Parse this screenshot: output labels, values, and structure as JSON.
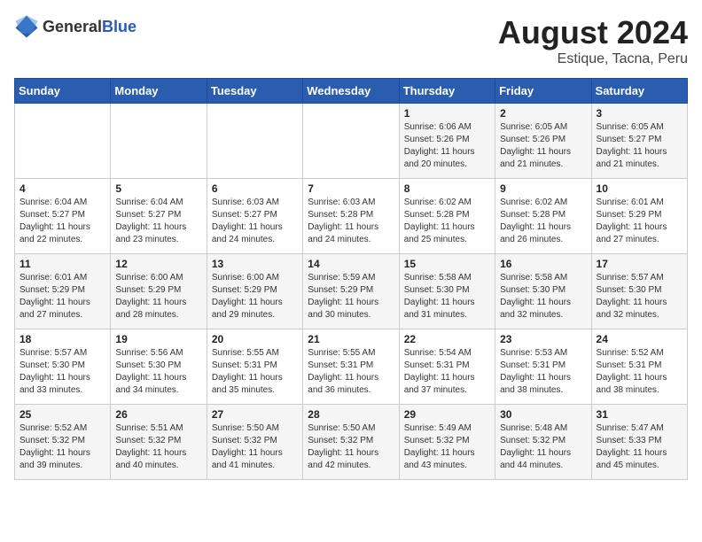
{
  "header": {
    "logo_general": "General",
    "logo_blue": "Blue",
    "month_year": "August 2024",
    "location": "Estique, Tacna, Peru"
  },
  "weekdays": [
    "Sunday",
    "Monday",
    "Tuesday",
    "Wednesday",
    "Thursday",
    "Friday",
    "Saturday"
  ],
  "weeks": [
    [
      {
        "day": "",
        "info": ""
      },
      {
        "day": "",
        "info": ""
      },
      {
        "day": "",
        "info": ""
      },
      {
        "day": "",
        "info": ""
      },
      {
        "day": "1",
        "info": "Sunrise: 6:06 AM\nSunset: 5:26 PM\nDaylight: 11 hours\nand 20 minutes."
      },
      {
        "day": "2",
        "info": "Sunrise: 6:05 AM\nSunset: 5:26 PM\nDaylight: 11 hours\nand 21 minutes."
      },
      {
        "day": "3",
        "info": "Sunrise: 6:05 AM\nSunset: 5:27 PM\nDaylight: 11 hours\nand 21 minutes."
      }
    ],
    [
      {
        "day": "4",
        "info": "Sunrise: 6:04 AM\nSunset: 5:27 PM\nDaylight: 11 hours\nand 22 minutes."
      },
      {
        "day": "5",
        "info": "Sunrise: 6:04 AM\nSunset: 5:27 PM\nDaylight: 11 hours\nand 23 minutes."
      },
      {
        "day": "6",
        "info": "Sunrise: 6:03 AM\nSunset: 5:27 PM\nDaylight: 11 hours\nand 24 minutes."
      },
      {
        "day": "7",
        "info": "Sunrise: 6:03 AM\nSunset: 5:28 PM\nDaylight: 11 hours\nand 24 minutes."
      },
      {
        "day": "8",
        "info": "Sunrise: 6:02 AM\nSunset: 5:28 PM\nDaylight: 11 hours\nand 25 minutes."
      },
      {
        "day": "9",
        "info": "Sunrise: 6:02 AM\nSunset: 5:28 PM\nDaylight: 11 hours\nand 26 minutes."
      },
      {
        "day": "10",
        "info": "Sunrise: 6:01 AM\nSunset: 5:29 PM\nDaylight: 11 hours\nand 27 minutes."
      }
    ],
    [
      {
        "day": "11",
        "info": "Sunrise: 6:01 AM\nSunset: 5:29 PM\nDaylight: 11 hours\nand 27 minutes."
      },
      {
        "day": "12",
        "info": "Sunrise: 6:00 AM\nSunset: 5:29 PM\nDaylight: 11 hours\nand 28 minutes."
      },
      {
        "day": "13",
        "info": "Sunrise: 6:00 AM\nSunset: 5:29 PM\nDaylight: 11 hours\nand 29 minutes."
      },
      {
        "day": "14",
        "info": "Sunrise: 5:59 AM\nSunset: 5:29 PM\nDaylight: 11 hours\nand 30 minutes."
      },
      {
        "day": "15",
        "info": "Sunrise: 5:58 AM\nSunset: 5:30 PM\nDaylight: 11 hours\nand 31 minutes."
      },
      {
        "day": "16",
        "info": "Sunrise: 5:58 AM\nSunset: 5:30 PM\nDaylight: 11 hours\nand 32 minutes."
      },
      {
        "day": "17",
        "info": "Sunrise: 5:57 AM\nSunset: 5:30 PM\nDaylight: 11 hours\nand 32 minutes."
      }
    ],
    [
      {
        "day": "18",
        "info": "Sunrise: 5:57 AM\nSunset: 5:30 PM\nDaylight: 11 hours\nand 33 minutes."
      },
      {
        "day": "19",
        "info": "Sunrise: 5:56 AM\nSunset: 5:30 PM\nDaylight: 11 hours\nand 34 minutes."
      },
      {
        "day": "20",
        "info": "Sunrise: 5:55 AM\nSunset: 5:31 PM\nDaylight: 11 hours\nand 35 minutes."
      },
      {
        "day": "21",
        "info": "Sunrise: 5:55 AM\nSunset: 5:31 PM\nDaylight: 11 hours\nand 36 minutes."
      },
      {
        "day": "22",
        "info": "Sunrise: 5:54 AM\nSunset: 5:31 PM\nDaylight: 11 hours\nand 37 minutes."
      },
      {
        "day": "23",
        "info": "Sunrise: 5:53 AM\nSunset: 5:31 PM\nDaylight: 11 hours\nand 38 minutes."
      },
      {
        "day": "24",
        "info": "Sunrise: 5:52 AM\nSunset: 5:31 PM\nDaylight: 11 hours\nand 38 minutes."
      }
    ],
    [
      {
        "day": "25",
        "info": "Sunrise: 5:52 AM\nSunset: 5:32 PM\nDaylight: 11 hours\nand 39 minutes."
      },
      {
        "day": "26",
        "info": "Sunrise: 5:51 AM\nSunset: 5:32 PM\nDaylight: 11 hours\nand 40 minutes."
      },
      {
        "day": "27",
        "info": "Sunrise: 5:50 AM\nSunset: 5:32 PM\nDaylight: 11 hours\nand 41 minutes."
      },
      {
        "day": "28",
        "info": "Sunrise: 5:50 AM\nSunset: 5:32 PM\nDaylight: 11 hours\nand 42 minutes."
      },
      {
        "day": "29",
        "info": "Sunrise: 5:49 AM\nSunset: 5:32 PM\nDaylight: 11 hours\nand 43 minutes."
      },
      {
        "day": "30",
        "info": "Sunrise: 5:48 AM\nSunset: 5:32 PM\nDaylight: 11 hours\nand 44 minutes."
      },
      {
        "day": "31",
        "info": "Sunrise: 5:47 AM\nSunset: 5:33 PM\nDaylight: 11 hours\nand 45 minutes."
      }
    ]
  ]
}
